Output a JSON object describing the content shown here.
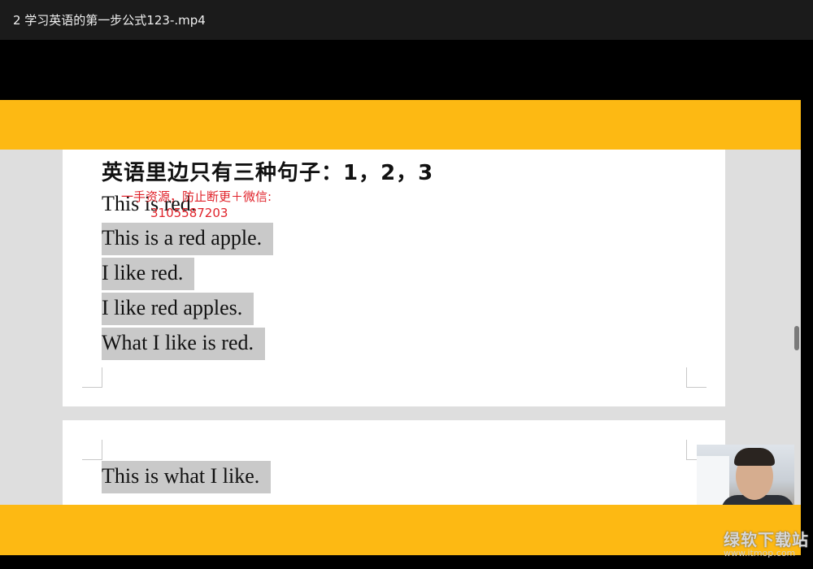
{
  "window": {
    "title": "2 学习英语的第一步公式123-.mp4"
  },
  "slide": {
    "heading": "英语里边只有三种句子：1，2，3",
    "lines": [
      "This is red.",
      "This is a red apple.",
      "I like red.",
      "I like red apples.",
      "What I like is red."
    ],
    "page2_line": "This is what I like."
  },
  "watermark": {
    "line1": "一手资源，防止断更＋微信:",
    "line2": "3105587203"
  },
  "site_logo": {
    "name": "绿软下载站",
    "url": "www.itmop.com"
  },
  "colors": {
    "band": "#fdb913",
    "highlight": "#c9c9c9",
    "watermark": "#e0222a"
  }
}
